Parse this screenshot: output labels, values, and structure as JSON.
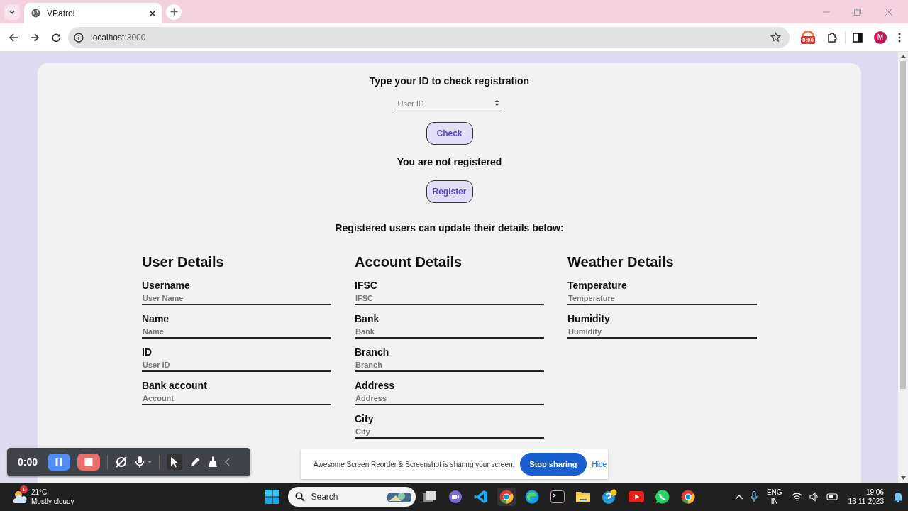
{
  "browser": {
    "tab": {
      "title": "VPatrol",
      "selected": true
    },
    "url_host": "localhost",
    "url_port": ":3000",
    "extension_badge": "0:00",
    "profile_initial": "M"
  },
  "page": {
    "check_title": "Type your ID to check registration",
    "id_field": {
      "placeholder": "User ID"
    },
    "check_button": "Check",
    "status": "You are not registered",
    "register_button": "Register",
    "update_title": "Registered users can update their details below:",
    "sections": [
      {
        "title": "User Details",
        "fields": [
          {
            "label": "Username",
            "placeholder": "User Name"
          },
          {
            "label": "Name",
            "placeholder": "Name"
          },
          {
            "label": "ID",
            "placeholder": "User ID"
          },
          {
            "label": "Bank account",
            "placeholder": "Account"
          }
        ]
      },
      {
        "title": "Account Details",
        "fields": [
          {
            "label": "IFSC",
            "placeholder": "IFSC"
          },
          {
            "label": "Bank",
            "placeholder": "Bank"
          },
          {
            "label": "Branch",
            "placeholder": "Branch"
          },
          {
            "label": "Address",
            "placeholder": "Address"
          },
          {
            "label": "City",
            "placeholder": "City"
          }
        ]
      },
      {
        "title": "Weather Details",
        "fields": [
          {
            "label": "Temperature",
            "placeholder": "Temperature"
          },
          {
            "label": "Humidity",
            "placeholder": "Humidity"
          }
        ]
      }
    ]
  },
  "recorder": {
    "time": "0:00"
  },
  "share_bar": {
    "message": "Awesome Screen Reorder & Screenshot is sharing your screen.",
    "stop_button": "Stop sharing",
    "hide_link": "Hide"
  },
  "taskbar": {
    "weather_badge": "1",
    "temperature": "21°C",
    "condition": "Mostly cloudy",
    "search_placeholder": "Search",
    "language": "ENG",
    "region": "IN",
    "time": "19:06",
    "date": "16-11-2023"
  }
}
